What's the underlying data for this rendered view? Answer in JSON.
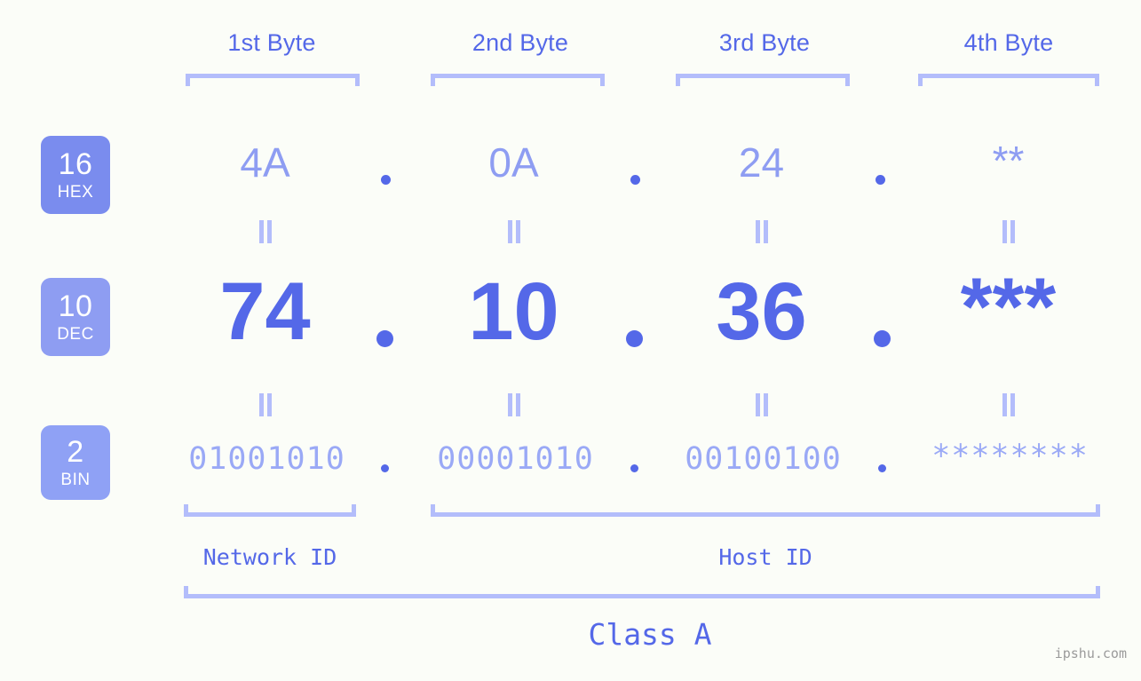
{
  "meta": {
    "background_color": "#fbfdf8",
    "accent_strong": "#5468e8",
    "accent_mid": "#8e9df2",
    "accent_light": "#b3bdfb"
  },
  "byte_headers": [
    {
      "label": "1st Byte"
    },
    {
      "label": "2nd Byte"
    },
    {
      "label": "3rd Byte"
    },
    {
      "label": "4th Byte"
    }
  ],
  "bases": [
    {
      "num": "16",
      "name": "HEX",
      "color": "#7a8cee"
    },
    {
      "num": "10",
      "name": "DEC",
      "color": "#8e9df2"
    },
    {
      "num": "2",
      "name": "BIN",
      "color": "#8fa1f5"
    }
  ],
  "rows": {
    "hex": {
      "values": [
        "4A",
        "0A",
        "24",
        "**"
      ],
      "separators": [
        ".",
        ".",
        "."
      ]
    },
    "dec": {
      "values": [
        "74",
        "10",
        "36",
        "***"
      ],
      "separators": [
        ".",
        ".",
        "."
      ]
    },
    "bin": {
      "values": [
        "01001010",
        "00001010",
        "00100100",
        "********"
      ],
      "separators": [
        ".",
        ".",
        "."
      ]
    }
  },
  "equality_symbol": "=",
  "segments": [
    {
      "label": "Network ID"
    },
    {
      "label": "Host ID"
    }
  ],
  "class_label": "Class A",
  "watermark": "ipshu.com"
}
